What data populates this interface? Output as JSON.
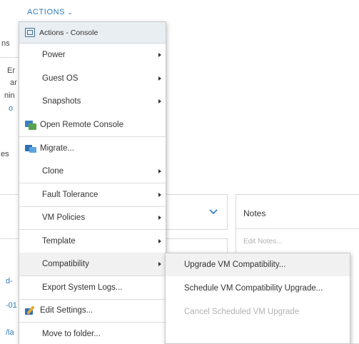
{
  "actions_button": {
    "label": "ACTIONS"
  },
  "background": {
    "fragments": [
      "ns",
      "Er",
      "ar",
      "nin",
      "o",
      "es",
      "d-",
      "-01",
      "/la"
    ],
    "notes_title": "Notes",
    "notes_placeholder": "Edit Notes..."
  },
  "menu": {
    "header": "Actions - Console",
    "items": [
      {
        "label": "Power",
        "submenu": true
      },
      {
        "label": "Guest OS",
        "submenu": true
      },
      {
        "label": "Snapshots",
        "submenu": true
      },
      {
        "label": "Open Remote Console",
        "icon": "remote-console-icon"
      },
      {
        "label": "Migrate...",
        "icon": "migrate-icon"
      },
      {
        "label": "Clone",
        "submenu": true
      },
      {
        "label": "Fault Tolerance",
        "submenu": true
      },
      {
        "label": "VM Policies",
        "submenu": true
      },
      {
        "label": "Template",
        "submenu": true
      },
      {
        "label": "Compatibility",
        "submenu": true,
        "active": true
      },
      {
        "label": "Export System Logs..."
      },
      {
        "label": "Edit Settings...",
        "icon": "edit-settings-icon"
      },
      {
        "label": "Move to folder..."
      }
    ]
  },
  "compatibility_submenu": {
    "items": [
      {
        "label": "Upgrade VM Compatibility...",
        "highlighted": true
      },
      {
        "label": "Schedule VM Compatibility Upgrade..."
      },
      {
        "label": "Cancel Scheduled VM Upgrade",
        "disabled": true
      }
    ]
  }
}
